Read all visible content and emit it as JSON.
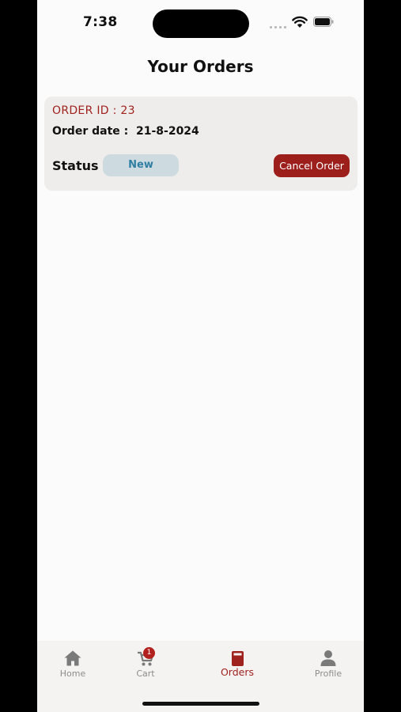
{
  "status_bar": {
    "time": "7:38"
  },
  "header": {
    "title": "Your Orders"
  },
  "orders": [
    {
      "order_id_label": "ORDER ID : 23",
      "order_date_label": "Order date :  21-8-2024",
      "status_label": "Status",
      "status_value": "New",
      "cancel_label": "Cancel Order"
    }
  ],
  "tab_bar": {
    "items": [
      {
        "label": "Home",
        "icon": "home-icon"
      },
      {
        "label": "Cart",
        "icon": "cart-icon",
        "badge": "1"
      },
      {
        "label": "Orders",
        "icon": "orders-icon",
        "active": true
      },
      {
        "label": "Profile",
        "icon": "profile-icon"
      }
    ]
  },
  "colors": {
    "accent": "#a0221f",
    "card_bg": "#efedeb",
    "status_badge_bg": "#cddbe0",
    "status_badge_text": "#2f7fa3"
  }
}
